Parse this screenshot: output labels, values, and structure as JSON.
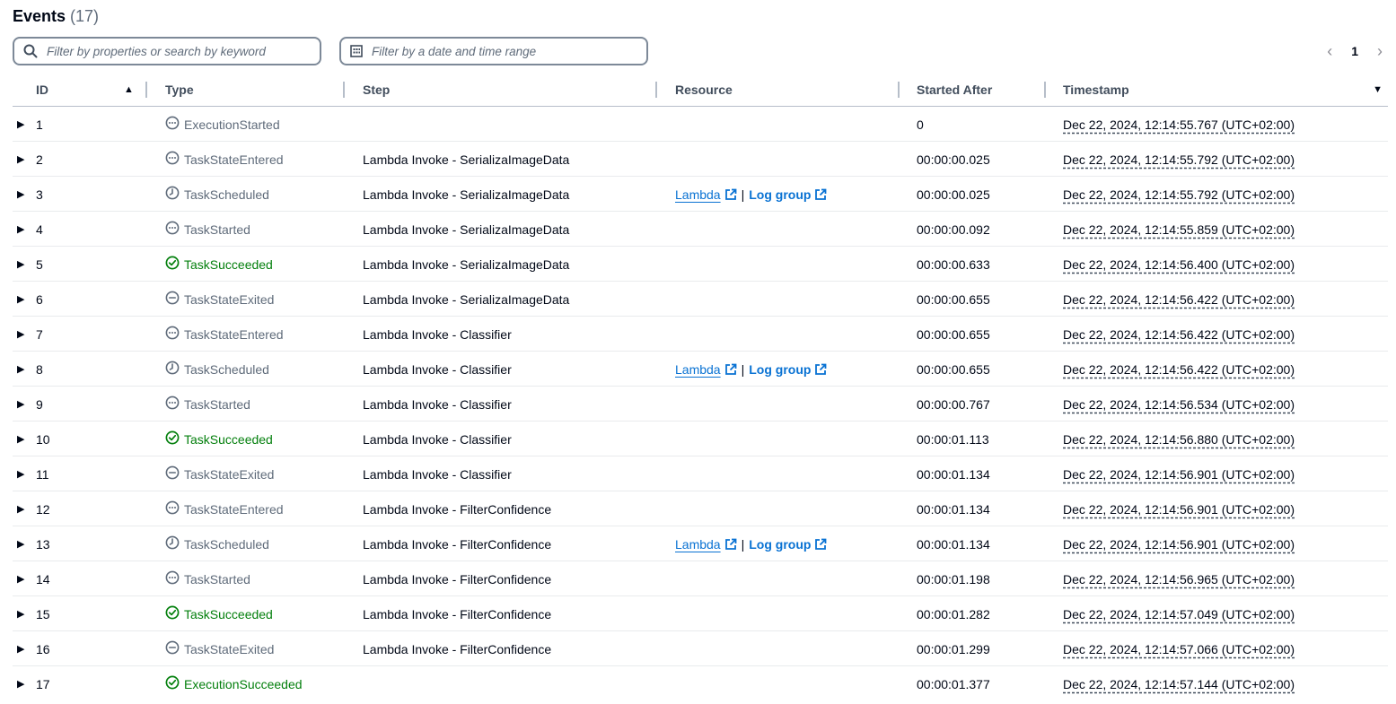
{
  "header": {
    "title": "Events",
    "count": "(17)"
  },
  "filters": {
    "search_placeholder": "Filter by properties or search by keyword",
    "date_placeholder": "Filter by a date and time range"
  },
  "pagination": {
    "current_page": "1",
    "prev_icon": "chevron-left-icon",
    "next_icon": "chevron-right-icon"
  },
  "columns": {
    "id": "ID",
    "type": "Type",
    "step": "Step",
    "resource": "Resource",
    "started_after": "Started After",
    "timestamp": "Timestamp"
  },
  "resource_links": {
    "lambda": "Lambda",
    "separator": "|",
    "log_group": "Log group"
  },
  "colors": {
    "success": "#037f0c",
    "link": "#0972d3",
    "muted": "#5f6b7a"
  },
  "rows": [
    {
      "id": "1",
      "type": "ExecutionStarted",
      "icon": "in-progress-icon",
      "status": "neutral",
      "step": "",
      "resource": false,
      "started_after": "0",
      "timestamp": "Dec 22, 2024, 12:14:55.767 (UTC+02:00)"
    },
    {
      "id": "2",
      "type": "TaskStateEntered",
      "icon": "in-progress-icon",
      "status": "neutral",
      "step": "Lambda Invoke - SerializaImageData",
      "resource": false,
      "started_after": "00:00:00.025",
      "timestamp": "Dec 22, 2024, 12:14:55.792 (UTC+02:00)"
    },
    {
      "id": "3",
      "type": "TaskScheduled",
      "icon": "clock-icon",
      "status": "neutral",
      "step": "Lambda Invoke - SerializaImageData",
      "resource": true,
      "started_after": "00:00:00.025",
      "timestamp": "Dec 22, 2024, 12:14:55.792 (UTC+02:00)"
    },
    {
      "id": "4",
      "type": "TaskStarted",
      "icon": "in-progress-icon",
      "status": "neutral",
      "step": "Lambda Invoke - SerializaImageData",
      "resource": false,
      "started_after": "00:00:00.092",
      "timestamp": "Dec 22, 2024, 12:14:55.859 (UTC+02:00)"
    },
    {
      "id": "5",
      "type": "TaskSucceeded",
      "icon": "check-circle-icon",
      "status": "success",
      "step": "Lambda Invoke - SerializaImageData",
      "resource": false,
      "started_after": "00:00:00.633",
      "timestamp": "Dec 22, 2024, 12:14:56.400 (UTC+02:00)"
    },
    {
      "id": "6",
      "type": "TaskStateExited",
      "icon": "minus-circle-icon",
      "status": "neutral",
      "step": "Lambda Invoke - SerializaImageData",
      "resource": false,
      "started_after": "00:00:00.655",
      "timestamp": "Dec 22, 2024, 12:14:56.422 (UTC+02:00)"
    },
    {
      "id": "7",
      "type": "TaskStateEntered",
      "icon": "in-progress-icon",
      "status": "neutral",
      "step": "Lambda Invoke - Classifier",
      "resource": false,
      "started_after": "00:00:00.655",
      "timestamp": "Dec 22, 2024, 12:14:56.422 (UTC+02:00)"
    },
    {
      "id": "8",
      "type": "TaskScheduled",
      "icon": "clock-icon",
      "status": "neutral",
      "step": "Lambda Invoke - Classifier",
      "resource": true,
      "started_after": "00:00:00.655",
      "timestamp": "Dec 22, 2024, 12:14:56.422 (UTC+02:00)"
    },
    {
      "id": "9",
      "type": "TaskStarted",
      "icon": "in-progress-icon",
      "status": "neutral",
      "step": "Lambda Invoke - Classifier",
      "resource": false,
      "started_after": "00:00:00.767",
      "timestamp": "Dec 22, 2024, 12:14:56.534 (UTC+02:00)"
    },
    {
      "id": "10",
      "type": "TaskSucceeded",
      "icon": "check-circle-icon",
      "status": "success",
      "step": "Lambda Invoke - Classifier",
      "resource": false,
      "started_after": "00:00:01.113",
      "timestamp": "Dec 22, 2024, 12:14:56.880 (UTC+02:00)"
    },
    {
      "id": "11",
      "type": "TaskStateExited",
      "icon": "minus-circle-icon",
      "status": "neutral",
      "step": "Lambda Invoke - Classifier",
      "resource": false,
      "started_after": "00:00:01.134",
      "timestamp": "Dec 22, 2024, 12:14:56.901 (UTC+02:00)"
    },
    {
      "id": "12",
      "type": "TaskStateEntered",
      "icon": "in-progress-icon",
      "status": "neutral",
      "step": "Lambda Invoke - FilterConfidence",
      "resource": false,
      "started_after": "00:00:01.134",
      "timestamp": "Dec 22, 2024, 12:14:56.901 (UTC+02:00)"
    },
    {
      "id": "13",
      "type": "TaskScheduled",
      "icon": "clock-icon",
      "status": "neutral",
      "step": "Lambda Invoke - FilterConfidence",
      "resource": true,
      "started_after": "00:00:01.134",
      "timestamp": "Dec 22, 2024, 12:14:56.901 (UTC+02:00)"
    },
    {
      "id": "14",
      "type": "TaskStarted",
      "icon": "in-progress-icon",
      "status": "neutral",
      "step": "Lambda Invoke - FilterConfidence",
      "resource": false,
      "started_after": "00:00:01.198",
      "timestamp": "Dec 22, 2024, 12:14:56.965 (UTC+02:00)"
    },
    {
      "id": "15",
      "type": "TaskSucceeded",
      "icon": "check-circle-icon",
      "status": "success",
      "step": "Lambda Invoke - FilterConfidence",
      "resource": false,
      "started_after": "00:00:01.282",
      "timestamp": "Dec 22, 2024, 12:14:57.049 (UTC+02:00)"
    },
    {
      "id": "16",
      "type": "TaskStateExited",
      "icon": "minus-circle-icon",
      "status": "neutral",
      "step": "Lambda Invoke - FilterConfidence",
      "resource": false,
      "started_after": "00:00:01.299",
      "timestamp": "Dec 22, 2024, 12:14:57.066 (UTC+02:00)"
    },
    {
      "id": "17",
      "type": "ExecutionSucceeded",
      "icon": "check-circle-icon",
      "status": "success",
      "step": "",
      "resource": false,
      "started_after": "00:00:01.377",
      "timestamp": "Dec 22, 2024, 12:14:57.144 (UTC+02:00)"
    }
  ]
}
